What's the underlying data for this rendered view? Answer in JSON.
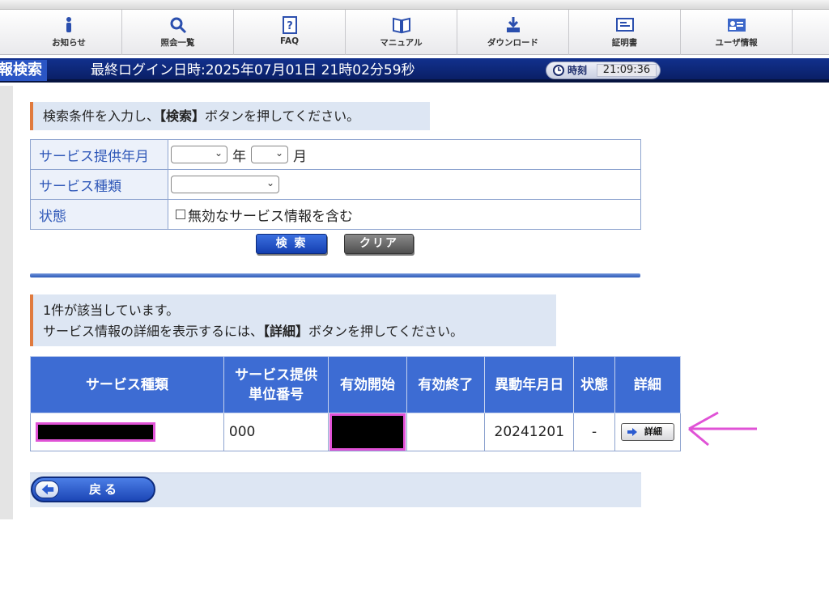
{
  "colors": {
    "nav_blue": "#12318e",
    "accent_orange": "#e07a3e",
    "table_header": "#3d6cd3",
    "label_blue": "#2f58b8",
    "highlight_pink": "#e052d6"
  },
  "nav": {
    "items": [
      {
        "label": "お知らせ",
        "icon": "info-icon"
      },
      {
        "label": "照会一覧",
        "icon": "search-icon"
      },
      {
        "label": "FAQ",
        "icon": "faq-icon"
      },
      {
        "label": "マニュアル",
        "icon": "book-icon"
      },
      {
        "label": "ダウンロード",
        "icon": "download-icon"
      },
      {
        "label": "証明書",
        "icon": "certificate-icon"
      },
      {
        "label": "ユーザ情報",
        "icon": "user-card-icon"
      }
    ]
  },
  "header": {
    "page_title": "報検索",
    "last_login": "最終ログイン日時:2025年07月01日 21時02分59秒",
    "clock_label": "時刻",
    "clock_time": "21:09:36"
  },
  "search": {
    "instruction_prefix": "検索条件を入力し、",
    "instruction_bold": "【検索】",
    "instruction_suffix": "ボタンを押してください。",
    "fields": {
      "period_label": "サービス提供年月",
      "year_unit": "年",
      "month_unit": "月",
      "service_type_label": "サービス種類",
      "status_label": "状態",
      "include_invalid_label": "無効なサービス情報を含む"
    },
    "search_button": "検 索",
    "clear_button": "クリア"
  },
  "results": {
    "count_text": "1件が該当しています。",
    "detail_instruction_prefix": "サービス情報の詳細を表示するには、",
    "detail_instruction_bold": "【詳細】",
    "detail_instruction_suffix": "ボタンを押してください。",
    "columns": {
      "service_type": "サービス種類",
      "unit_number_line1": "サービス提供",
      "unit_number_line2": "単位番号",
      "valid_start": "有効開始",
      "valid_end": "有効終了",
      "change_date": "異動年月日",
      "status": "状態",
      "detail": "詳細"
    },
    "rows": [
      {
        "unit_number": "000",
        "valid_end": "",
        "change_date": "20241201",
        "status": "-",
        "detail_button": "詳細"
      }
    ]
  },
  "footer": {
    "back_button": "戻る"
  }
}
